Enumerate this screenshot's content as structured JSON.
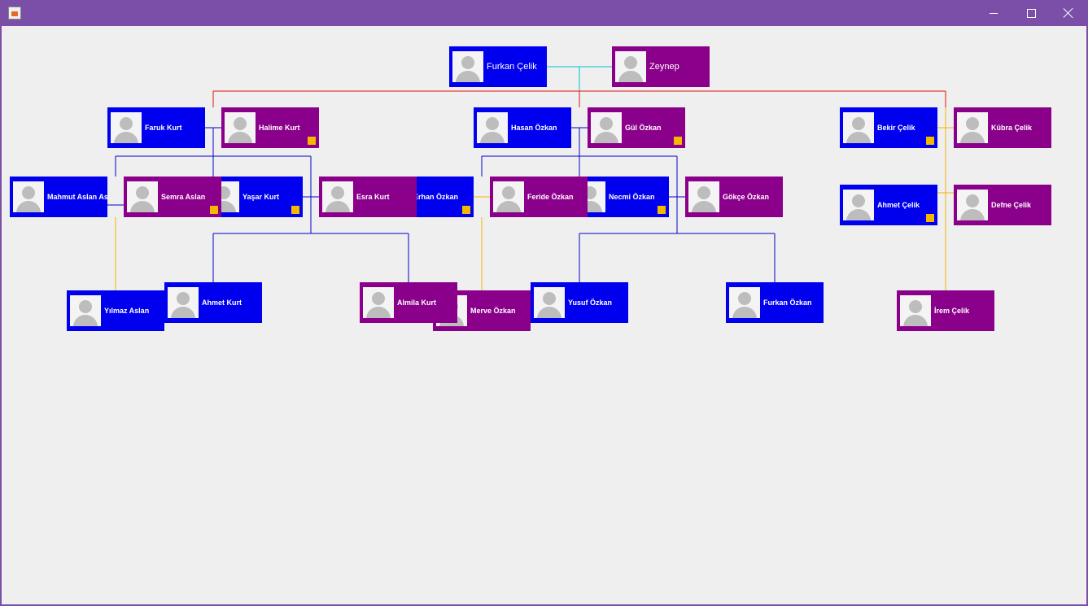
{
  "window": {
    "title": "",
    "buttons": {
      "minimize": "minimize-icon",
      "maximize": "maximize-icon",
      "close": "close-icon"
    }
  },
  "colors": {
    "male": "#0000ee",
    "female": "#8b008b",
    "badge": "#f5b800",
    "line_child": "#0000cc",
    "line_root_children": "#e01010",
    "line_root_marriage": "#00c0d0",
    "line_marriage": "#f0b400",
    "background": "#efefef"
  },
  "people": [
    {
      "id": "furkan-celik",
      "name": "Furkan Çelik",
      "gender": "male",
      "badge": false,
      "large": true
    },
    {
      "id": "zeynep",
      "name": "Zeynep",
      "gender": "female",
      "badge": false,
      "large": true
    },
    {
      "id": "faruk-kurt",
      "name": "Faruk Kurt",
      "gender": "male",
      "badge": false
    },
    {
      "id": "halime-kurt",
      "name": "Halime Kurt",
      "gender": "female",
      "badge": true
    },
    {
      "id": "hasan-ozkan",
      "name": "Hasan Özkan",
      "gender": "male",
      "badge": false
    },
    {
      "id": "gul-ozkan",
      "name": "Gül Özkan",
      "gender": "female",
      "badge": true
    },
    {
      "id": "bekir-celik",
      "name": "Bekir Çelik",
      "gender": "male",
      "badge": true
    },
    {
      "id": "kubra-celik",
      "name": "Kübra Çelik",
      "gender": "female",
      "badge": false
    },
    {
      "id": "mahmut-aslan",
      "name": "Mahmut Aslan Aslan",
      "gender": "male",
      "badge": false
    },
    {
      "id": "yasar-kurt",
      "name": "Yaşar Kurt",
      "gender": "male",
      "badge": true
    },
    {
      "id": "semra-aslan",
      "name": "Semra Aslan",
      "gender": "female",
      "badge": true
    },
    {
      "id": "erhan-ozkan",
      "name": "Erhan Özkan",
      "gender": "male",
      "badge": true
    },
    {
      "id": "esra-kurt",
      "name": "Esra Kurt",
      "gender": "female",
      "badge": false
    },
    {
      "id": "necmi-ozkan",
      "name": "Necmi Özkan",
      "gender": "male",
      "badge": true
    },
    {
      "id": "feride-ozkan",
      "name": "Feride Özkan",
      "gender": "female",
      "badge": false
    },
    {
      "id": "gokce-ozkan",
      "name": "Gökçe Özkan",
      "gender": "female",
      "badge": false
    },
    {
      "id": "ahmet-celik",
      "name": "Ahmet Çelik",
      "gender": "male",
      "badge": true
    },
    {
      "id": "defne-celik",
      "name": "Defne Çelik",
      "gender": "female",
      "badge": false
    },
    {
      "id": "yilmaz-aslan",
      "name": "Yılmaz Aslan",
      "gender": "male",
      "badge": false
    },
    {
      "id": "ahmet-kurt",
      "name": "Ahmet Kurt",
      "gender": "male",
      "badge": false
    },
    {
      "id": "merve-ozkan",
      "name": "Merve Özkan",
      "gender": "female",
      "badge": false
    },
    {
      "id": "almila-kurt",
      "name": "Almila Kurt",
      "gender": "female",
      "badge": false
    },
    {
      "id": "yusuf-ozkan",
      "name": "Yusuf Özkan",
      "gender": "male",
      "badge": false
    },
    {
      "id": "furkan-ozkan",
      "name": "Furkan Özkan",
      "gender": "male",
      "badge": false
    },
    {
      "id": "irem-celik",
      "name": "İrem Çelik",
      "gender": "female",
      "badge": false
    }
  ]
}
